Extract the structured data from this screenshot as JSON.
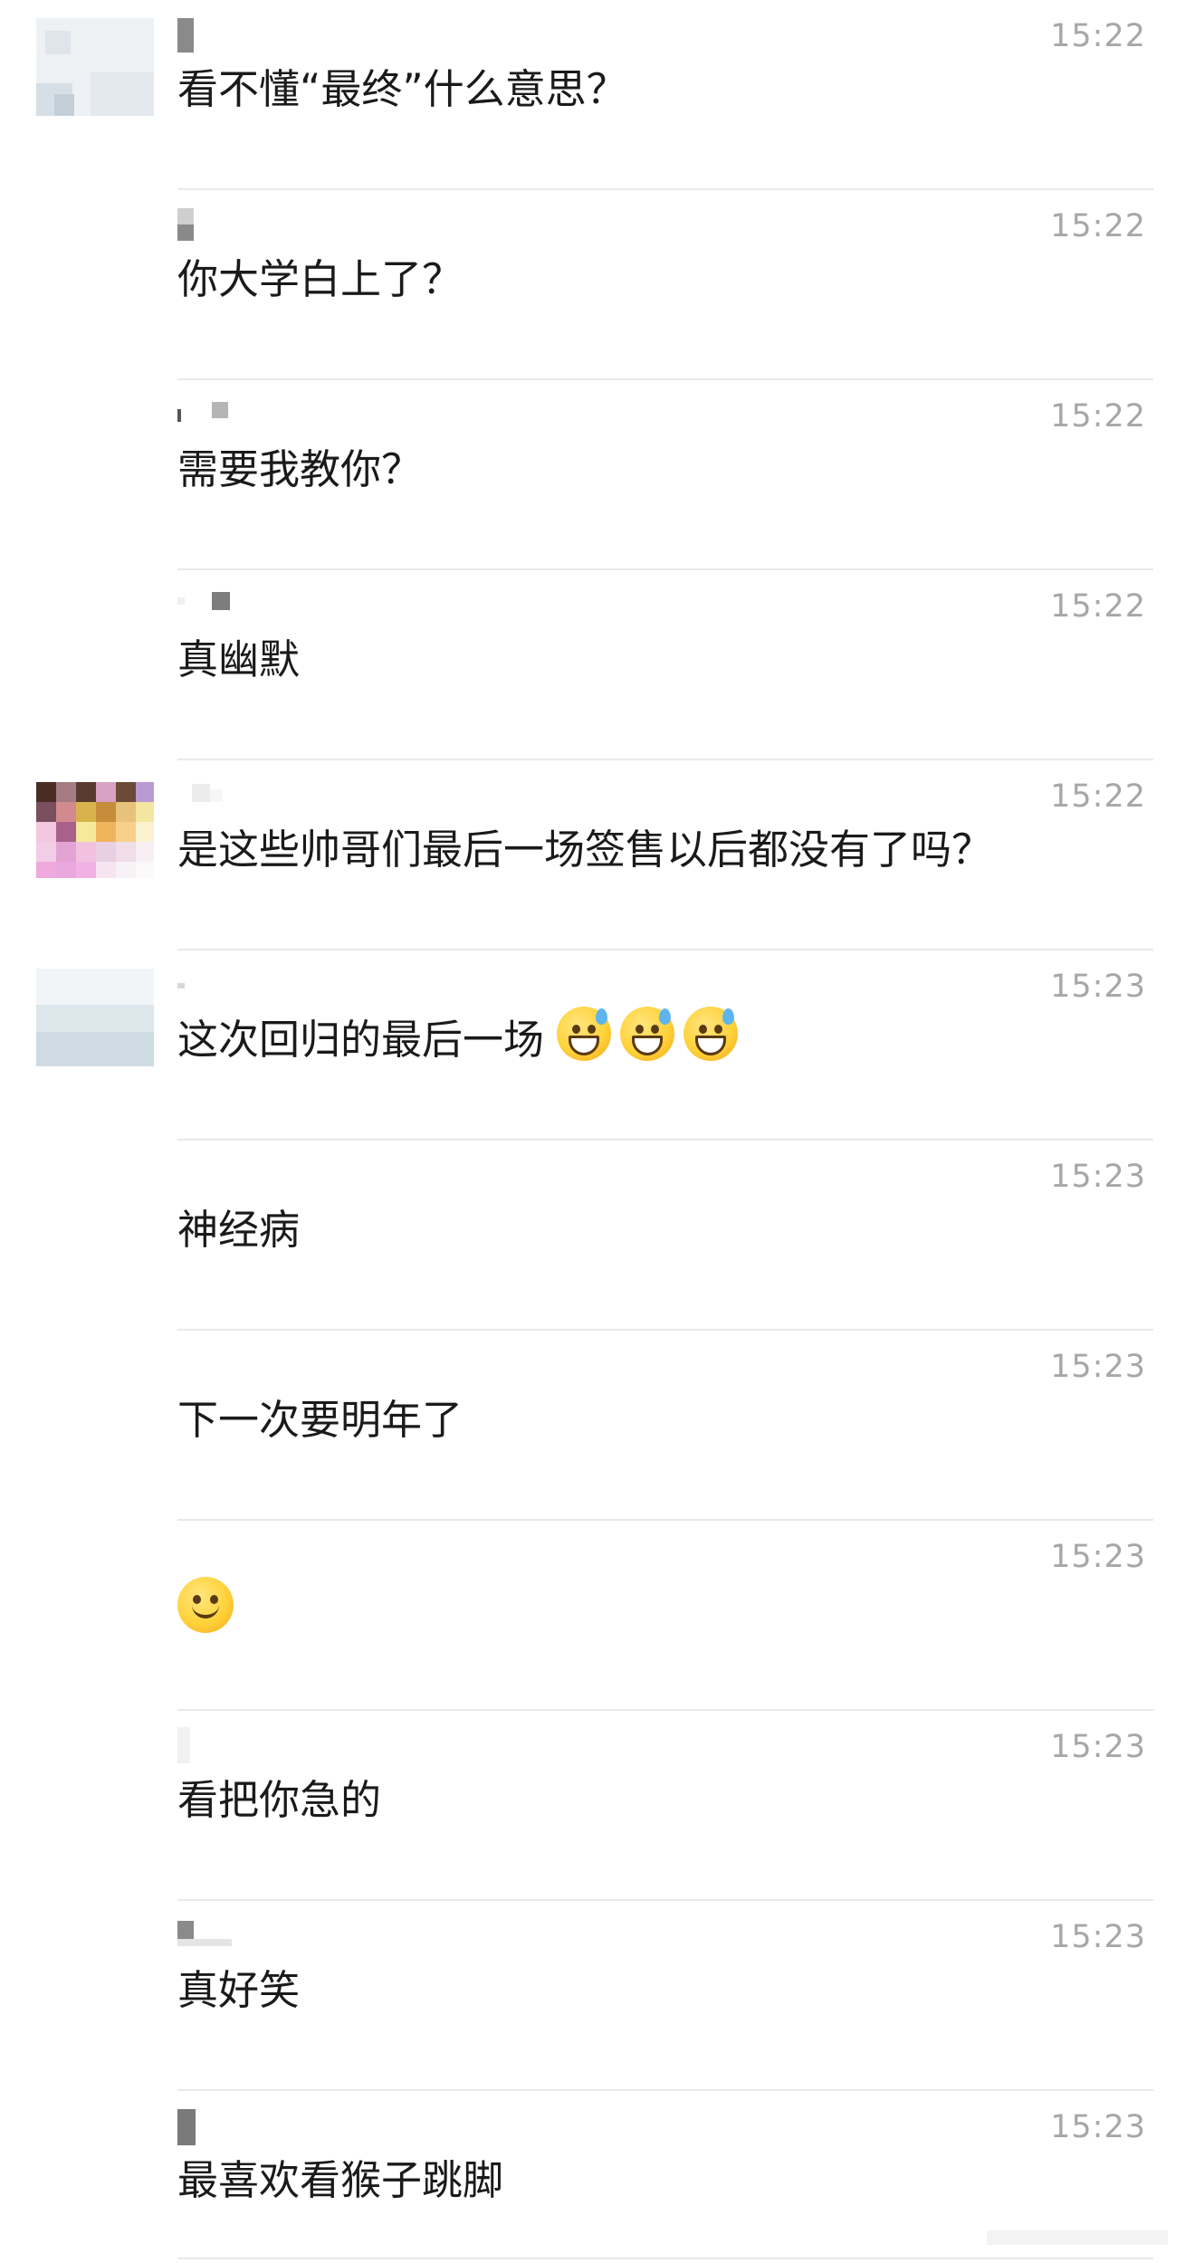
{
  "comments": [
    {
      "time": "15:22",
      "text": "看不懂“最终”什么意思？",
      "avatar": "avatar-light-gray"
    },
    {
      "time": "15:22",
      "text": "你大学白上了？"
    },
    {
      "time": "15:22",
      "text": "需要我教你？"
    },
    {
      "time": "15:22",
      "text": "真幽默"
    },
    {
      "time": "15:22",
      "text": "是这些帅哥们最后一场签售以后都没有了吗？",
      "avatar": "avatar-colorful"
    },
    {
      "time": "15:23",
      "text": "这次回归的最后一场",
      "emojis": [
        "sweat-smile-emoji",
        "sweat-smile-emoji",
        "sweat-smile-emoji"
      ],
      "avatar": "avatar-light-blue"
    },
    {
      "time": "15:23",
      "text": "神经病"
    },
    {
      "time": "15:23",
      "text": "下一次要明年了"
    },
    {
      "time": "15:23",
      "text": "",
      "emojis": [
        "slight-smile-emoji"
      ]
    },
    {
      "time": "15:23",
      "text": "看把你急的"
    },
    {
      "time": "15:23",
      "text": "真好笑"
    },
    {
      "time": "15:23",
      "text": "最喜欢看猴子跳脚"
    }
  ],
  "colors": {
    "timestamp": "#a7a7a7",
    "text": "#1a1a1a",
    "divider": "#e9e9e9"
  }
}
